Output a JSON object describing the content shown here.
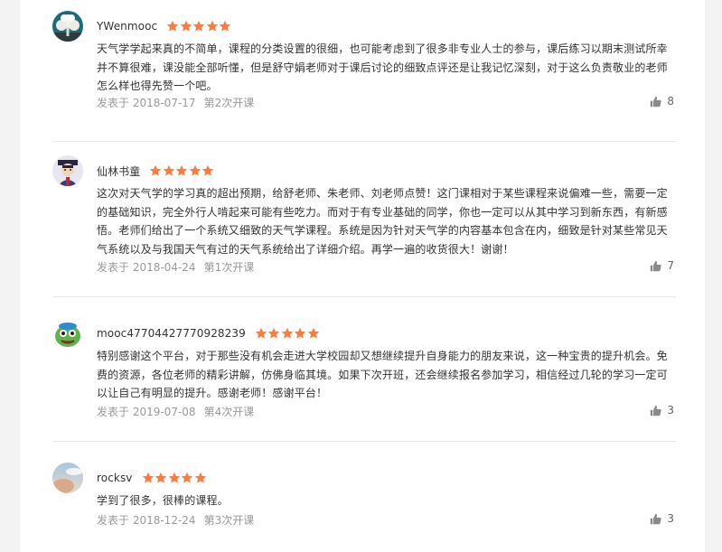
{
  "reviews": [
    {
      "username": "YWenmooc",
      "rating": 5,
      "content": "天气学学起来真的不简单，课程的分类设置的很细，也可能考虑到了很多非专业人士的参与，课后练习以期末测试所幸并不算很难，课没能全部听懂，但是舒守娟老师对于课后讨论的细致点评还是让我记忆深刻，对于这么负责敬业的老师怎么样也得先赞一个吧。",
      "date": "发表于 2018-07-17",
      "term": "第2次开课",
      "likes": "8",
      "avatar_icon": "white-tree-avatar"
    },
    {
      "username": "仙林书童",
      "rating": 5,
      "content": "这次对天气学的学习真的超出预期，给舒老师、朱老师、刘老师点赞！这门课相对于某些课程来说偏难一些，需要一定的基础知识，完全外行人啃起来可能有些吃力。而对于有专业基础的同学，你也一定可以从其中学习到新东西，有新感悟。老师们给出了一个系统又细致的天气学课程。系统是因为针对天气学的内容基本包含在内，细致是针对某些常见天气系统以及与我国天气有过的天气系统给出了详细介绍。再学一遍的收货很大！谢谢！",
      "date": "发表于 2018-04-24",
      "term": "第1次开课",
      "likes": "7",
      "avatar_icon": "cartoon-scholar-avatar"
    },
    {
      "username": "mooc47704427770928239",
      "rating": 5,
      "content": "特别感谢这个平台，对于那些没有机会走进大学校园却又想继续提升自身能力的朋友来说，这一种宝贵的提升机会。免费的资源，各位老师的精彩讲解，仿佛身临其境。如果下次开班，还会继续报名参加学习，相信经过几轮的学习一定可以让自己有明显的提升。感谢老师！感谢平台！",
      "date": "发表于 2019-07-08",
      "term": "第4次开课",
      "likes": "3",
      "avatar_icon": "green-monster-avatar"
    },
    {
      "username": "rocksv",
      "rating": 5,
      "content": "学到了很多，很棒的课程。",
      "date": "发表于 2018-12-24",
      "term": "第3次开课",
      "likes": "3",
      "avatar_icon": "sky-photo-avatar"
    }
  ],
  "colors": {
    "star": "#ff7b3a",
    "text": "#333333",
    "meta": "#999999",
    "divider": "#e8e8e8"
  }
}
